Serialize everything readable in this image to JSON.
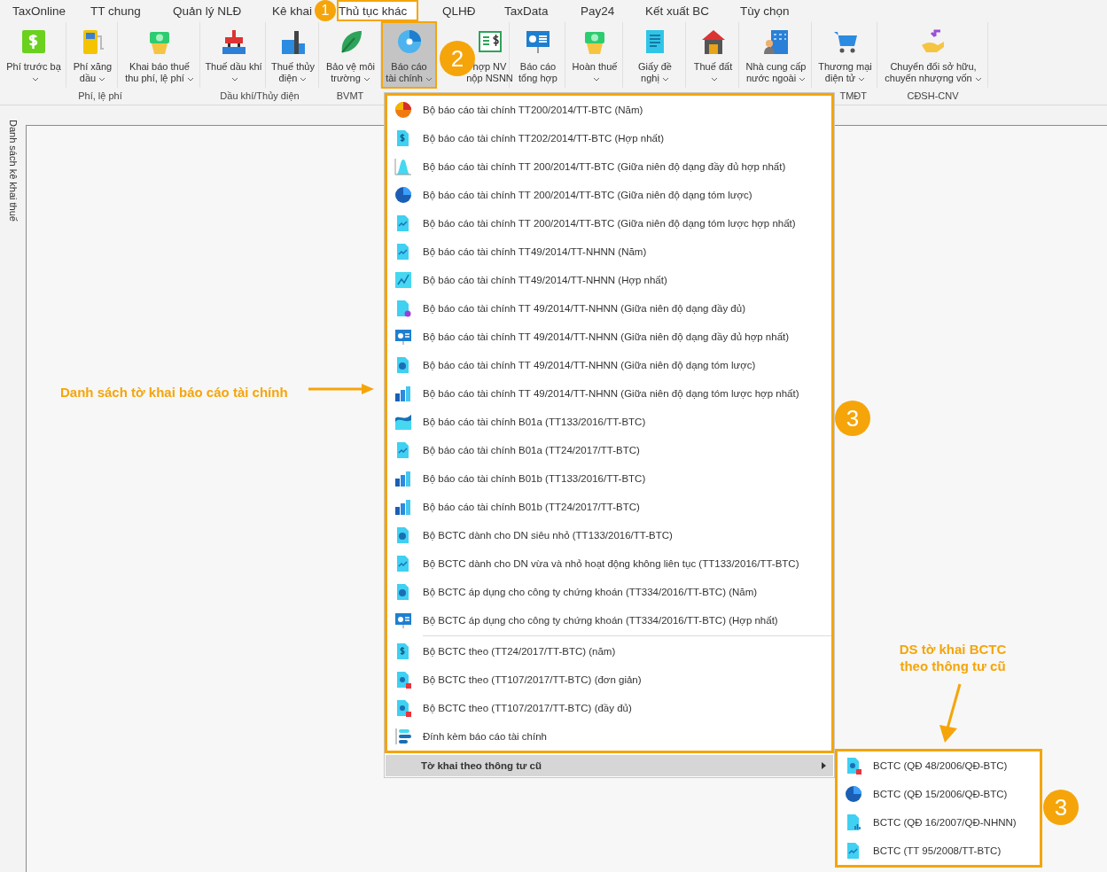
{
  "tabs": [
    {
      "label": "TaxOnline",
      "selected": false
    },
    {
      "label": "TT chung",
      "selected": false
    },
    {
      "label": "Quản lý NLĐ",
      "selected": false
    },
    {
      "label": "Kê khai",
      "selected": false
    },
    {
      "label": "Thủ tục khác",
      "selected": true
    },
    {
      "label": "QLHĐ",
      "selected": false
    },
    {
      "label": "TaxData",
      "selected": false
    },
    {
      "label": "Pay24",
      "selected": false
    },
    {
      "label": "Kết xuất BC",
      "selected": false
    },
    {
      "label": "Tùy chọn",
      "selected": false
    }
  ],
  "ribbon": {
    "groups": [
      {
        "label": "Phí, lệ phí",
        "buttons": [
          {
            "lines": [
              "Phí trước bạ"
            ],
            "dropdown": true,
            "selected": false
          },
          {
            "lines": [
              "Phí xăng",
              "dầu"
            ],
            "dropdown": true,
            "selected": false
          },
          {
            "lines": [
              "Khai báo thuế",
              "thu phí, lệ phí"
            ],
            "dropdown": true,
            "selected": false
          }
        ]
      },
      {
        "label": "Dầu khí/Thủy điện",
        "buttons": [
          {
            "lines": [
              "Thuế dầu khí"
            ],
            "dropdown": true,
            "selected": false
          },
          {
            "lines": [
              "Thuế thủy",
              "điện"
            ],
            "dropdown": true,
            "selected": false
          }
        ]
      },
      {
        "label": "BVMT",
        "buttons": [
          {
            "lines": [
              "Bảo vệ môi",
              "trường"
            ],
            "dropdown": true,
            "selected": false
          }
        ]
      },
      {
        "buttons": [
          {
            "lines": [
              "Báo cáo",
              "tài chính"
            ],
            "dropdown": true,
            "selected": true
          },
          {
            "lines": [
              "hợp NV",
              "nộp NSNN"
            ],
            "dropdown": false,
            "selected": false
          },
          {
            "lines": [
              "Báo cáo",
              "tổng hợp"
            ],
            "dropdown": false,
            "selected": false
          },
          {
            "lines": [
              "Hoàn thuế"
            ],
            "dropdown": true,
            "selected": false
          },
          {
            "lines": [
              "Giấy đề",
              "nghị"
            ],
            "dropdown": true,
            "selected": false
          },
          {
            "lines": [
              "Thuế đất"
            ],
            "dropdown": true,
            "selected": false
          },
          {
            "lines": [
              "Nhà cung cấp",
              "nước ngoài"
            ],
            "dropdown": true,
            "selected": false
          }
        ]
      },
      {
        "label": "TMĐT",
        "buttons": [
          {
            "lines": [
              "Thương mại",
              "điện tử"
            ],
            "dropdown": true,
            "selected": false
          }
        ]
      },
      {
        "label": "CĐSH-CNV",
        "buttons": [
          {
            "lines": [
              "Chuyển đổi sở hữu,",
              "chuyển nhượng vốn"
            ],
            "dropdown": true,
            "selected": false
          }
        ]
      }
    ]
  },
  "side_tab": {
    "label": "Danh sách kê khai thuế"
  },
  "menu": {
    "sections": [
      [
        "Bộ báo cáo tài chính TT200/2014/TT-BTC (Năm)",
        "Bộ báo cáo tài chính TT202/2014/TT-BTC (Hợp nhất)",
        "Bộ báo cáo tài chính TT 200/2014/TT-BTC (Giữa niên độ dạng đầy đủ hợp nhất)",
        "Bộ báo cáo tài chính TT 200/2014/TT-BTC (Giữa niên độ dạng tóm lược)",
        "Bộ báo cáo tài chính TT 200/2014/TT-BTC (Giữa niên độ dạng tóm lược hợp nhất)",
        "Bộ báo cáo tài chính TT49/2014/TT-NHNN (Năm)",
        "Bộ báo cáo tài chính TT49/2014/TT-NHNN (Hợp nhất)",
        "Bộ báo cáo tài chính TT 49/2014/TT-NHNN (Giữa niên độ dạng đầy đủ)",
        "Bộ báo cáo tài chính TT 49/2014/TT-NHNN (Giữa niên độ dạng đầy đủ hợp nhất)",
        "Bộ báo cáo tài chính TT 49/2014/TT-NHNN (Giữa niên độ dạng tóm lược)",
        "Bộ báo cáo tài chính TT 49/2014/TT-NHNN (Giữa niên độ dạng tóm lược hợp nhất)",
        "Bộ báo cáo tài chính B01a (TT133/2016/TT-BTC)",
        "Bộ báo cáo tài chính B01a (TT24/2017/TT-BTC)",
        "Bộ báo cáo tài chính B01b (TT133/2016/TT-BTC)",
        "Bộ báo cáo tài chính B01b (TT24/2017/TT-BTC)",
        "Bộ BCTC dành cho DN siêu nhỏ (TT133/2016/TT-BTC)",
        "Bộ BCTC dành cho DN vừa và nhỏ hoạt động không liên tục (TT133/2016/TT-BTC)",
        "Bộ BCTC áp dụng cho công ty chứng khoán (TT334/2016/TT-BTC) (Năm)",
        "Bộ BCTC áp dụng cho công ty chứng khoán (TT334/2016/TT-BTC) (Hợp nhất)"
      ],
      [
        "Bộ BCTC theo (TT24/2017/TT-BTC) (năm)",
        "Bộ BCTC theo (TT107/2017/TT-BTC) (đơn giản)",
        "Bộ BCTC theo (TT107/2017/TT-BTC) (đầy đủ)",
        "Đính kèm báo cáo tài chính"
      ]
    ],
    "submenu_item": {
      "label": "Tờ khai theo thông tư cũ",
      "selected": true
    }
  },
  "submenu": {
    "items": [
      "BCTC (QĐ 48/2006/QĐ-BTC)",
      "BCTC (QĐ 15/2006/QĐ-BTC)",
      "BCTC (QĐ 16/2007/QĐ-NHNN)",
      "BCTC (TT 95/2008/TT-BTC)"
    ]
  },
  "annotations": {
    "callouts": [
      "1",
      "2",
      "3",
      "3"
    ],
    "notes": [
      "Danh sách tờ khai báo cáo tài chính",
      "DS tờ khai BCTC theo thông tư cũ"
    ]
  }
}
